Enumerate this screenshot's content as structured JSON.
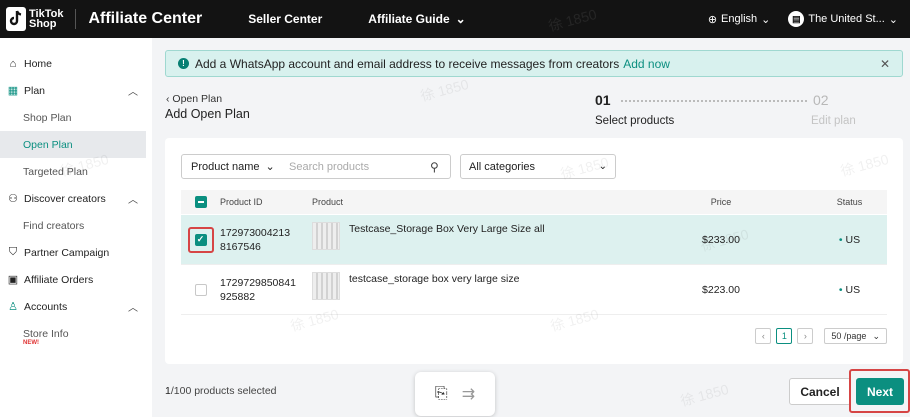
{
  "topbar": {
    "logo_line1": "TikTok",
    "logo_line2": "Shop",
    "brand": "Affiliate Center",
    "nav": [
      "Seller Center",
      "Affiliate Guide"
    ],
    "language": "English",
    "region": "The United St..."
  },
  "sidebar": {
    "items": [
      {
        "label": "Home",
        "icon": "home-icon"
      },
      {
        "label": "Plan",
        "icon": "plan-icon"
      },
      {
        "label": "Shop Plan"
      },
      {
        "label": "Open Plan"
      },
      {
        "label": "Targeted Plan"
      },
      {
        "label": "Discover creators",
        "icon": "people-icon"
      },
      {
        "label": "Find creators"
      },
      {
        "label": "Partner Campaign",
        "icon": "shield-icon"
      },
      {
        "label": "Affiliate Orders",
        "icon": "clipboard-icon"
      },
      {
        "label": "Accounts",
        "icon": "user-icon"
      },
      {
        "label": "Store Info"
      }
    ],
    "new_badge": "NEW!"
  },
  "banner": {
    "text": "Add a WhatsApp account and email address to receive messages from creators",
    "link": "Add now"
  },
  "breadcrumb": "Open Plan",
  "page_title": "Add Open Plan",
  "steps": [
    {
      "num": "01",
      "label": "Select products"
    },
    {
      "num": "02",
      "label": "Edit plan"
    }
  ],
  "filters": {
    "search_field": "Product name",
    "search_placeholder": "Search products",
    "category": "All categories"
  },
  "table": {
    "headers": {
      "id": "Product ID",
      "product": "Product",
      "price": "Price",
      "status": "Status"
    },
    "rows": [
      {
        "id_line1": "172973004213",
        "id_line2": "8167546",
        "product": "Testcase_Storage Box Very Large Size all",
        "price": "$233.00",
        "status": "US",
        "checked": true
      },
      {
        "id_line1": "1729729850841",
        "id_line2": "925882",
        "product": "testcase_storage box very large size",
        "price": "$223.00",
        "status": "US",
        "checked": false
      }
    ]
  },
  "pagination": {
    "current": "1",
    "per_page": "50 /page"
  },
  "footer": {
    "selected_count": "1",
    "selected_suffix": "/100 products selected",
    "cancel": "Cancel",
    "next": "Next"
  },
  "watermark": "徐 1850",
  "colors": {
    "accent": "#0b8f80",
    "highlight": "#d64545",
    "topbar": "#131313"
  }
}
